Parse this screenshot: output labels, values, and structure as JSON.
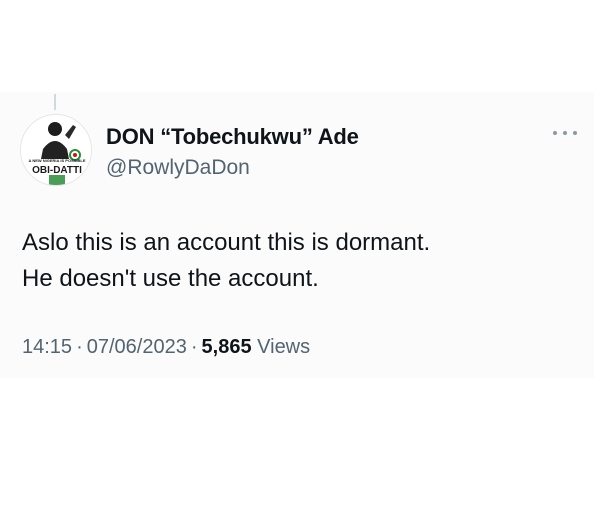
{
  "tweet": {
    "author": {
      "display_name": "DON “Tobechukwu” Ade",
      "handle": "@RowlyDaDon",
      "avatar_icon": "profile-photo-campaign-badge",
      "avatar_text": {
        "top": "A NEW NIGERIA IS POSSIBLE",
        "main": "OBI-DATTI"
      }
    },
    "text_lines": [
      "Aslo this is an account this is dormant.",
      "He doesn't use the account."
    ],
    "meta": {
      "time": "14:15",
      "date": "07/06/2023",
      "views_count": "5,865",
      "views_label": "Views",
      "separator": "·"
    },
    "more_icon": "more-horizontal-icon"
  },
  "colors": {
    "text_primary": "#0f1419",
    "text_secondary": "#536471",
    "icon_gray": "#8a99a6",
    "card_background": "#fbfbfb",
    "campaign_green": "#2e8b3a",
    "campaign_red": "#c8102e"
  }
}
